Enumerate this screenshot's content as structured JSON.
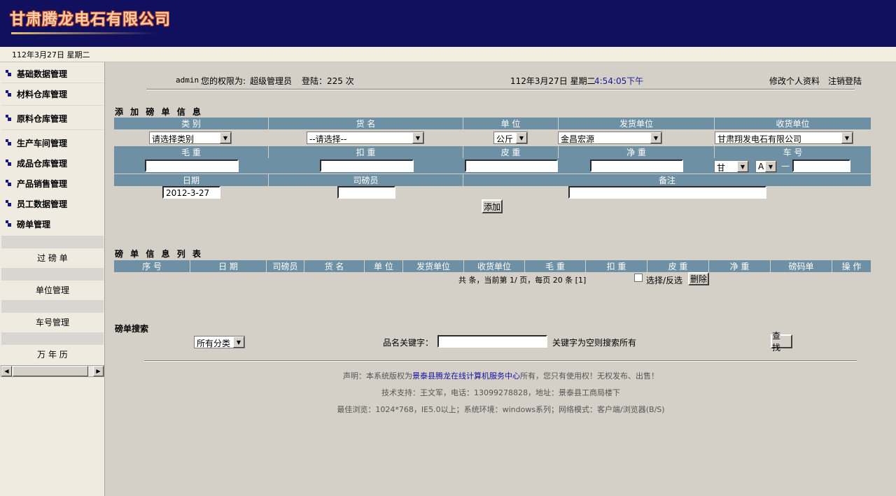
{
  "header": {
    "logo_text": "甘肃腾龙电石有限公司"
  },
  "datebar": {
    "date": "112年3月27日  星期二"
  },
  "sidebar": {
    "items": [
      {
        "label": "基础数据管理"
      },
      {
        "label": "材料仓库管理"
      },
      {
        "label": "原料仓库管理"
      },
      {
        "label": "生产车间管理"
      },
      {
        "label": "成品仓库管理"
      },
      {
        "label": "产品销售管理"
      },
      {
        "label": "员工数据管理"
      },
      {
        "label": "磅单管理"
      }
    ],
    "sub_items": [
      {
        "label": "过 磅 单"
      },
      {
        "label": "单位管理"
      },
      {
        "label": "车号管理"
      },
      {
        "label": "万 年 历"
      }
    ]
  },
  "topbar": {
    "user": "admin",
    "perm_label": "您的权限为:",
    "role": "超级管理员",
    "login_label": "登陆：225 次",
    "date": "112年3月27日  星期二",
    "time": "4:54:05下午",
    "edit_profile": "修改个人资料",
    "logout": "注销登陆"
  },
  "add_form": {
    "title": "添 加 磅 单 信 息",
    "row1_headers": [
      "类 别",
      "货 名",
      "单 位",
      "发货单位",
      "收货单位"
    ],
    "category_value": "请选择类别",
    "goods_value": "--请选择--",
    "unit_value": "公斤",
    "sender_value": "金昌宏源",
    "receiver_value": "甘肃翔发电石有限公司",
    "row2_headers": [
      "毛 重",
      "扣 重",
      "皮 重",
      "净 重",
      "车 号"
    ],
    "plate_prefix": "甘",
    "plate_letter": "A",
    "plate_dash": "—",
    "row3_headers": [
      "日期",
      "司磅员",
      "备注"
    ],
    "date_value": "2012-3-27",
    "add_button": "添加"
  },
  "list": {
    "title": "磅 单 信 息 列 表",
    "columns": [
      "序 号",
      "日 期",
      "司磅员",
      "货 名",
      "单 位",
      "发货单位",
      "收货单位",
      "毛 重",
      "扣 重",
      "皮 重",
      "净 重",
      "磅码单",
      "操 作"
    ],
    "pagination": "共  条，当前第 1/ 页，每页 20 条 [1]",
    "select_label": "选择/反选",
    "delete_button": "删除"
  },
  "search": {
    "title": "磅单搜索",
    "category_value": "所有分类",
    "keyword_label": "品名关键字：",
    "keyword_value": "",
    "hint": "关键字为空则搜索所有",
    "search_button": "查 找"
  },
  "footer": {
    "line1_pre": "声明：本系统版权为",
    "line1_link": "景泰县腾龙在线计算机服务中心",
    "line1_post": "所有，您只有使用权！无权发布、出售！",
    "line2": "技术支持：王文军，电话：13099278828，地址：景泰县工商局楼下",
    "line3": "最佳浏览：1024*768，IE5.0以上；系统环境：windows系列；网络模式：客户端/浏览器(B/S)"
  },
  "colors": {
    "header_bg": "#10105e",
    "table_header": "#6e90a4",
    "link": "#1212a0"
  }
}
